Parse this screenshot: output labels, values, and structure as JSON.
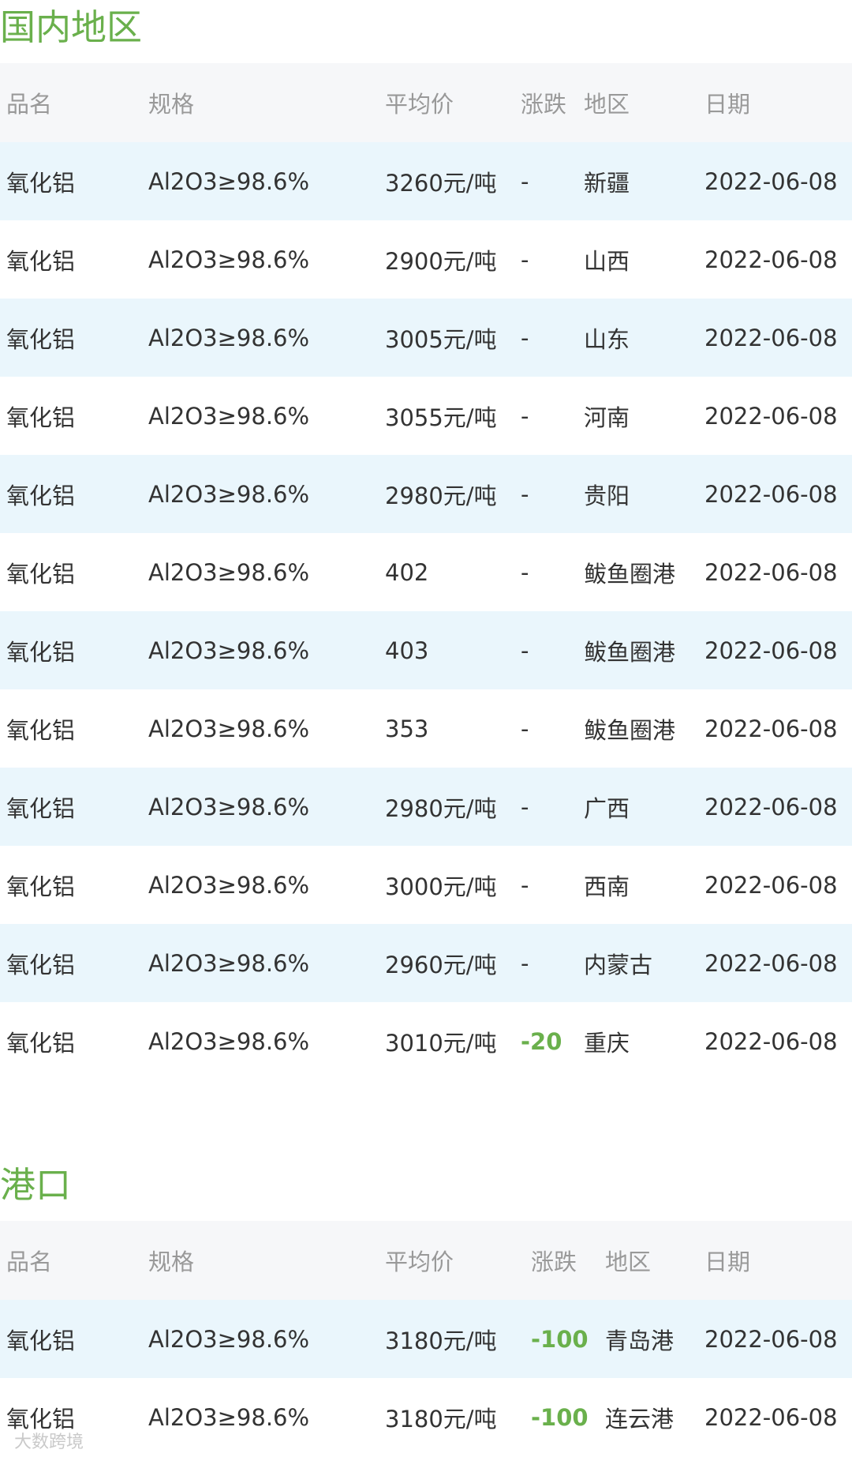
{
  "sections": [
    {
      "title": "国内地区",
      "headers": {
        "name": "品名",
        "spec": "规格",
        "price": "平均价",
        "change": "涨跌",
        "region": "地区",
        "date": "日期"
      },
      "rows": [
        {
          "name": "氧化铝",
          "spec": "Al2O3≥98.6%",
          "price": "3260元/吨",
          "change": "-",
          "region": "新疆",
          "date": "2022-06-08"
        },
        {
          "name": "氧化铝",
          "spec": "Al2O3≥98.6%",
          "price": "2900元/吨",
          "change": "-",
          "region": "山西",
          "date": "2022-06-08"
        },
        {
          "name": "氧化铝",
          "spec": "Al2O3≥98.6%",
          "price": "3005元/吨",
          "change": "-",
          "region": "山东",
          "date": "2022-06-08"
        },
        {
          "name": "氧化铝",
          "spec": "Al2O3≥98.6%",
          "price": "3055元/吨",
          "change": "-",
          "region": "河南",
          "date": "2022-06-08"
        },
        {
          "name": "氧化铝",
          "spec": "Al2O3≥98.6%",
          "price": "2980元/吨",
          "change": "-",
          "region": "贵阳",
          "date": "2022-06-08"
        },
        {
          "name": "氧化铝",
          "spec": "Al2O3≥98.6%",
          "price": "402",
          "change": "-",
          "region": "鲅鱼圈港",
          "date": "2022-06-08"
        },
        {
          "name": "氧化铝",
          "spec": "Al2O3≥98.6%",
          "price": "403",
          "change": "-",
          "region": "鲅鱼圈港",
          "date": "2022-06-08"
        },
        {
          "name": "氧化铝",
          "spec": "Al2O3≥98.6%",
          "price": "353",
          "change": "-",
          "region": "鲅鱼圈港",
          "date": "2022-06-08"
        },
        {
          "name": "氧化铝",
          "spec": "Al2O3≥98.6%",
          "price": "2980元/吨",
          "change": "-",
          "region": "广西",
          "date": "2022-06-08"
        },
        {
          "name": "氧化铝",
          "spec": "Al2O3≥98.6%",
          "price": "3000元/吨",
          "change": "-",
          "region": "西南",
          "date": "2022-06-08"
        },
        {
          "name": "氧化铝",
          "spec": "Al2O3≥98.6%",
          "price": "2960元/吨",
          "change": "-",
          "region": "内蒙古",
          "date": "2022-06-08"
        },
        {
          "name": "氧化铝",
          "spec": "Al2O3≥98.6%",
          "price": "3010元/吨",
          "change": "-20",
          "region": "重庆",
          "date": "2022-06-08"
        }
      ]
    },
    {
      "title": "港口",
      "headers": {
        "name": "品名",
        "spec": "规格",
        "price": "平均价",
        "change": "涨跌",
        "region": "地区",
        "date": "日期"
      },
      "rows": [
        {
          "name": "氧化铝",
          "spec": "Al2O3≥98.6%",
          "price": "3180元/吨",
          "change": "-100",
          "region": "青岛港",
          "date": "2022-06-08"
        },
        {
          "name": "氧化铝",
          "spec": "Al2O3≥98.6%",
          "price": "3180元/吨",
          "change": "-100",
          "region": "连云港",
          "date": "2022-06-08"
        }
      ]
    }
  ],
  "watermark": "大数跨境",
  "colors": {
    "accent": "#6ab04c",
    "row_alt": "#eaf6fc",
    "header_bg": "#f6f7f9"
  }
}
